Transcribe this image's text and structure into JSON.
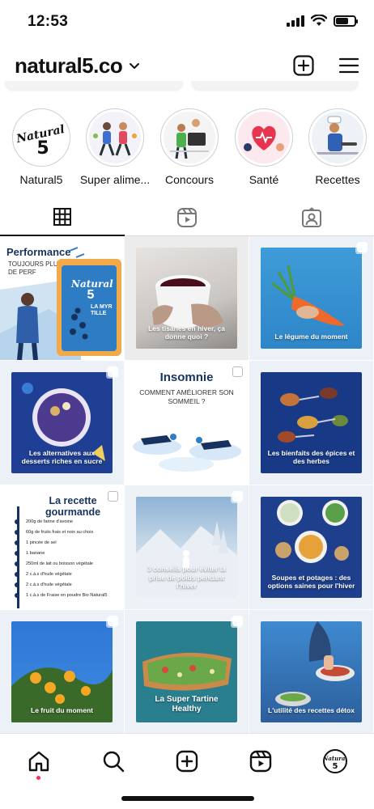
{
  "status_bar": {
    "time": "12:53",
    "battery_level": 0.7
  },
  "header": {
    "account_name": "natural5.co"
  },
  "highlights": [
    {
      "label": "Natural5",
      "icon": "brand-logo"
    },
    {
      "label": "Super alime...",
      "icon": "runners-illustration"
    },
    {
      "label": "Concours",
      "icon": "contest-illustration"
    },
    {
      "label": "Santé",
      "icon": "health-illustration"
    },
    {
      "label": "Recettes",
      "icon": "chef-illustration"
    }
  ],
  "logo": {
    "line1": "Natural",
    "line2": "5"
  },
  "tabs": [
    {
      "name": "grid",
      "icon": "grid-icon",
      "active": true
    },
    {
      "name": "reels",
      "icon": "reels-icon",
      "active": false
    },
    {
      "name": "tagged",
      "icon": "tagged-icon",
      "active": false
    }
  ],
  "posts": [
    {
      "title": "Performance",
      "subtitle": "TOUJOURS PLUS DE PERF",
      "pack_text": "LA MYR TILLE",
      "multi": false
    },
    {
      "caption": "Les tisanes en hiver, ça donne quoi ?",
      "multi": false
    },
    {
      "caption": "Le légume du moment",
      "multi": true
    },
    {
      "caption": "Les alternatives aux desserts riches en sucre",
      "multi": true
    },
    {
      "title": "Insomnie",
      "subtitle": "COMMENT AMÉLIORER SON SOMMEIL ?",
      "multi": true
    },
    {
      "caption": "Les bienfaits des épices et des herbes",
      "multi": false
    },
    {
      "title": "La recette gourmande",
      "ingredients": [
        "200g de farine d'avoine",
        "60g de fruits frais et noix au choix",
        "1 pincée de sel",
        "1 banane",
        "250ml de lait ou boisson végétale",
        "2 c.à.s d'huile végétale",
        "2 c.à.s d'huile végétale",
        "1 c.à.s de Fraise en poudre Bio Natural5"
      ],
      "multi": true
    },
    {
      "caption": "3 conseils pour éviter la prise de poids pendant l'hiver",
      "multi": true
    },
    {
      "caption": "Soupes et potages : des options saines pour l'hiver",
      "multi": false
    },
    {
      "caption": "Le fruit du moment",
      "multi": true
    },
    {
      "caption": "La Super Tartine Healthy",
      "multi": true
    },
    {
      "caption": "L'utilité des recettes détox",
      "multi": false
    }
  ],
  "bottom_nav": [
    {
      "name": "home",
      "icon": "home-icon"
    },
    {
      "name": "search",
      "icon": "search-icon"
    },
    {
      "name": "create",
      "icon": "plus-square-icon"
    },
    {
      "name": "reels",
      "icon": "reels-icon"
    },
    {
      "name": "profile",
      "icon": "profile-avatar"
    }
  ],
  "colors": {
    "accent_blue": "#2e7cc4",
    "navy": "#17325e",
    "notification": "#ff2d55"
  }
}
